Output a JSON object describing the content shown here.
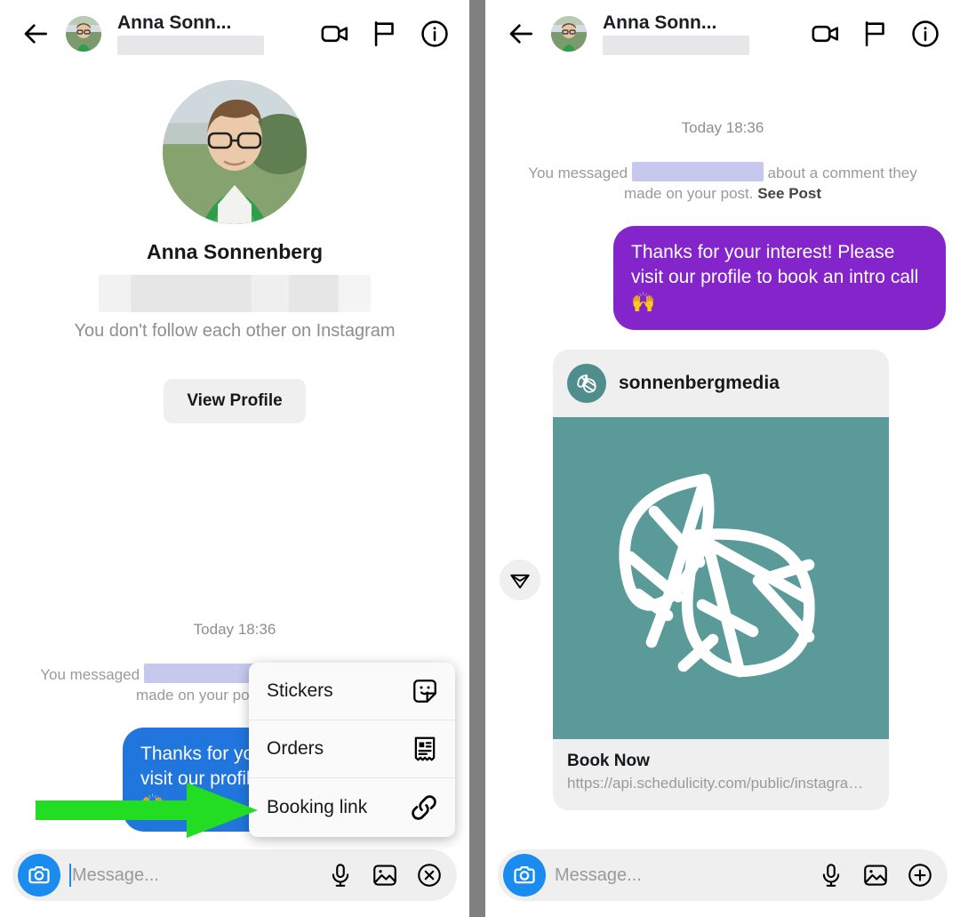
{
  "header": {
    "back_icon": "back-arrow-icon",
    "avatar": "contact-avatar",
    "name": "Anna Sonn...",
    "redacted_handle": "",
    "video_icon": "video-camera-icon",
    "flag_icon": "flag-icon",
    "info_icon": "info-icon"
  },
  "profile": {
    "name": "Anna Sonnenberg",
    "redacted_handle": "",
    "follow_status": "You don't follow each other on Instagram",
    "view_profile_label": "View Profile"
  },
  "thread": {
    "timestamp": "Today 18:36",
    "system_note_prefix": "You messaged",
    "system_note_middle": "about a comment they",
    "system_note_suffix": "made on your post.",
    "see_post_label": "See Post",
    "outgoing_message": "Thanks for your interest! Please visit our profile to book an intro call",
    "outgoing_emoji": "🙌",
    "bubble_color_left": "#2176dd",
    "bubble_color_right": "#8425cc"
  },
  "link_card": {
    "send_icon": "send-paper-plane-icon",
    "logo_icon": "sonnenbergmedia-leaf-logo",
    "handle": "sonnenbergmedia",
    "image_alt": "leaf-logo-image",
    "image_color": "#5a9a99",
    "title": "Book Now",
    "url": "https://api.schedulicity.com/public/instagra…"
  },
  "composer": {
    "camera_icon": "camera-icon",
    "placeholder": "Message...",
    "mic_icon": "microphone-icon",
    "gallery_icon": "image-gallery-icon",
    "close_icon": "close-circle-icon",
    "add_icon": "plus-circle-icon"
  },
  "popup_menu": {
    "items": [
      {
        "label": "Stickers",
        "icon": "sticker-icon"
      },
      {
        "label": "Orders",
        "icon": "receipt-icon"
      },
      {
        "label": "Booking link",
        "icon": "chain-link-icon"
      }
    ]
  },
  "annotation": {
    "arrow_color": "#22dd22",
    "arrow_icon": "green-pointer-arrow"
  }
}
